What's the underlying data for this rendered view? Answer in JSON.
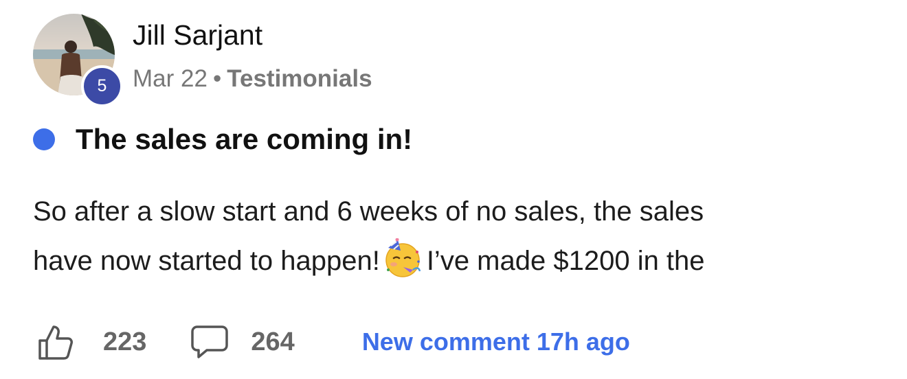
{
  "author": {
    "name": "Jill Sarjant",
    "level": "5",
    "avatar_icon": "avatar-beach-photo"
  },
  "meta": {
    "date": "Mar 22",
    "separator": "•",
    "category": "Testimonials"
  },
  "post": {
    "title": "The sales are coming in!",
    "unread_color": "#3d6ee8",
    "body_line1": "So after a slow start and 6 weeks of no sales, the sales",
    "body_line2_before": "have now started to happen!",
    "body_emoji": "partying-face-icon",
    "body_line2_after": "I’ve made $1200 in the"
  },
  "actions": {
    "like_icon": "thumbs-up-icon",
    "like_count": "223",
    "comment_icon": "comment-bubble-icon",
    "comment_count": "264",
    "new_comment_label": "New comment 17h ago",
    "link_color": "#3d6ee8"
  },
  "colors": {
    "level_badge": "#3c4aa6",
    "meta_text": "#777777"
  }
}
